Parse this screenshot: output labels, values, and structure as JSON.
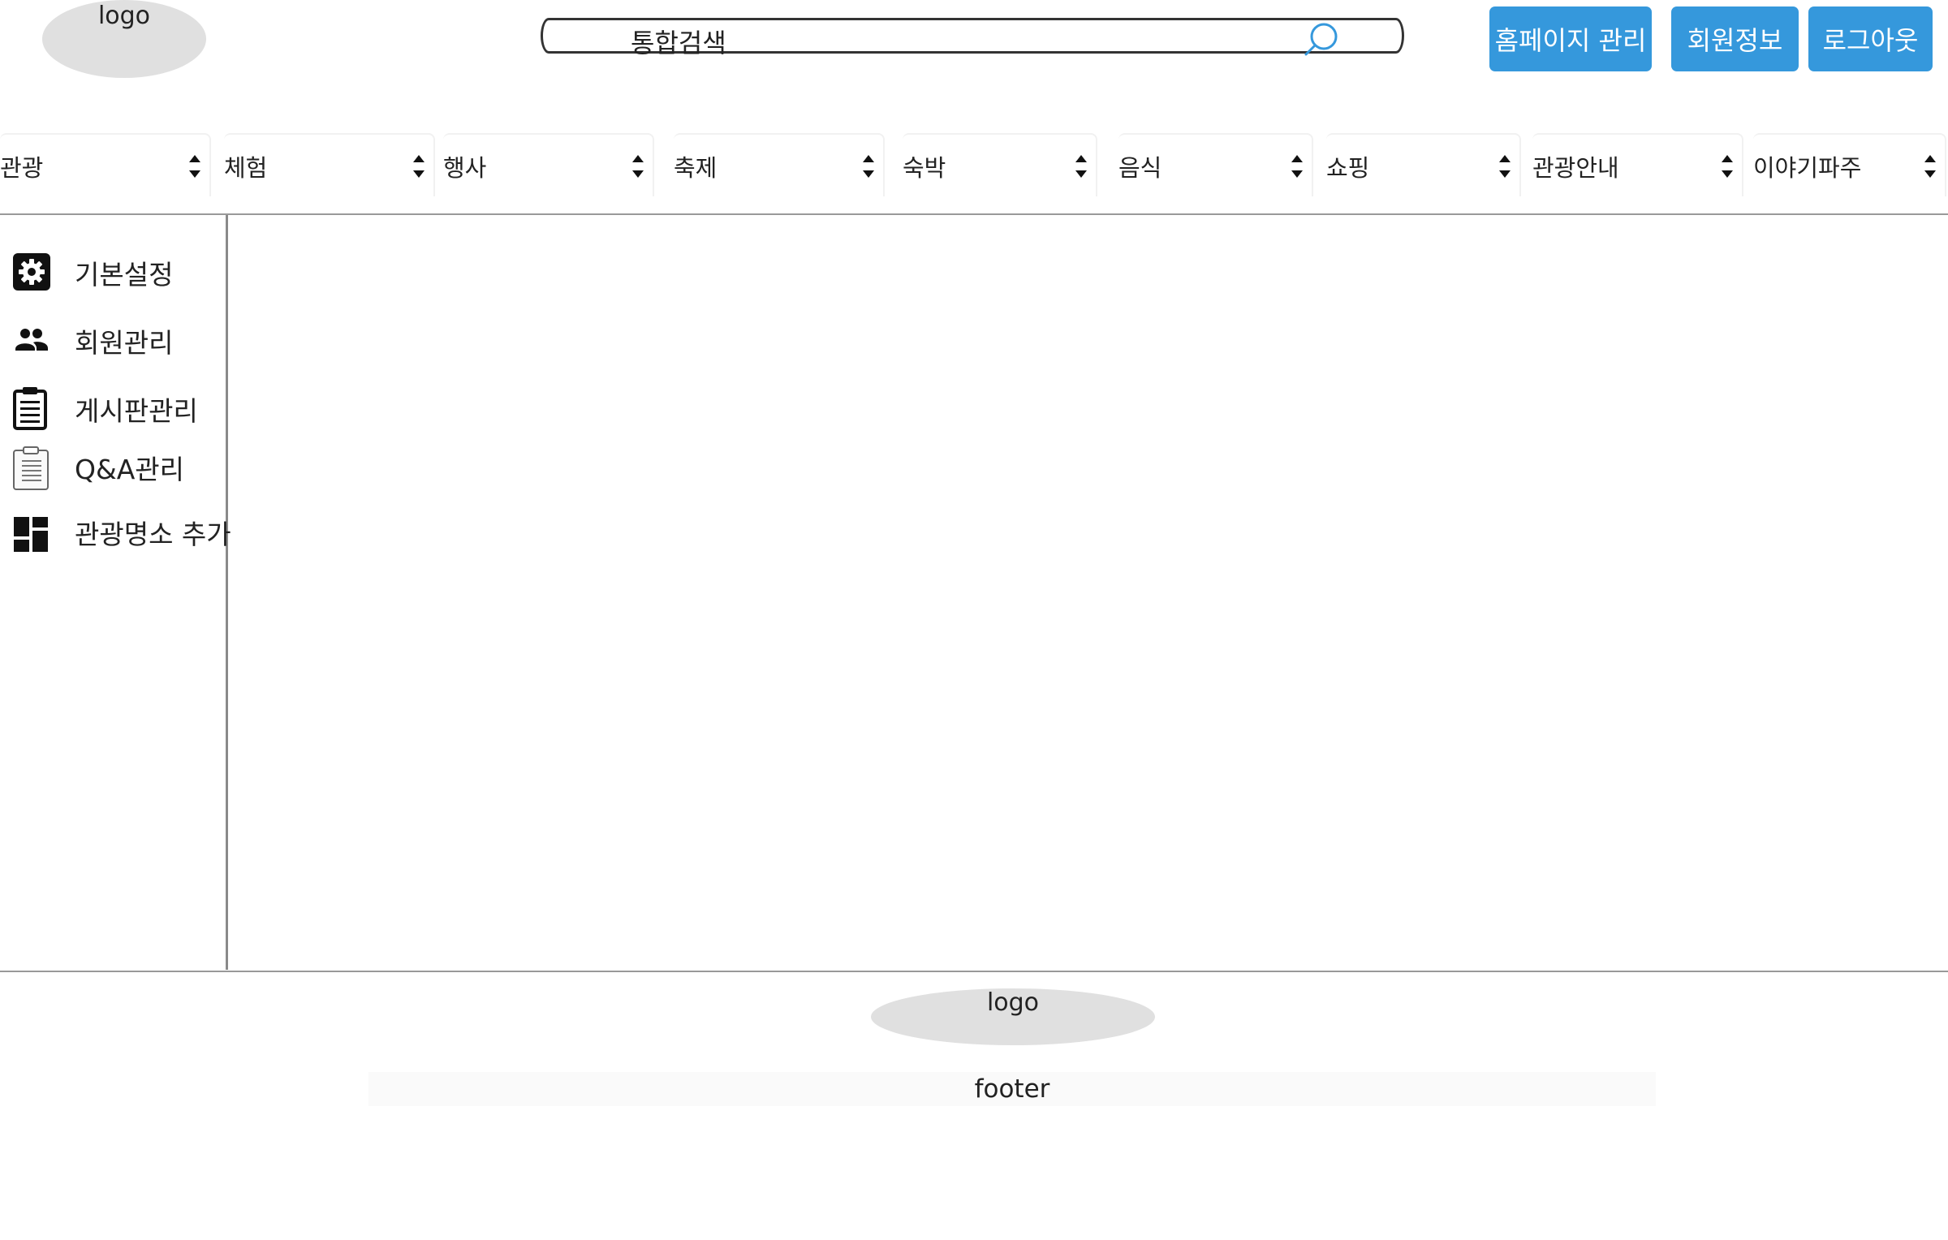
{
  "header": {
    "logo_text": "logo",
    "search_placeholder": "통합검색",
    "buttons": {
      "homepage_admin": "홈페이지 관리",
      "member_info": "회원정보",
      "logout": "로그아웃"
    }
  },
  "nav": {
    "items": [
      "관광",
      "체험",
      "행사",
      "축제",
      "숙박",
      "음식",
      "쇼핑",
      "관광안내",
      "이야기파주"
    ]
  },
  "sidebar": {
    "items": [
      {
        "label": "기본설정",
        "icon": "gear-icon"
      },
      {
        "label": "회원관리",
        "icon": "people-icon"
      },
      {
        "label": "게시판관리",
        "icon": "clipboard-icon"
      },
      {
        "label": "Q&A관리",
        "icon": "clipboard-outline-icon"
      },
      {
        "label": "관광명소 추가",
        "icon": "dashboard-icon"
      }
    ]
  },
  "footer": {
    "logo_text": "logo",
    "text": "footer"
  },
  "colors": {
    "accent": "#3598dc",
    "logo_bg": "#e0e0e0"
  }
}
